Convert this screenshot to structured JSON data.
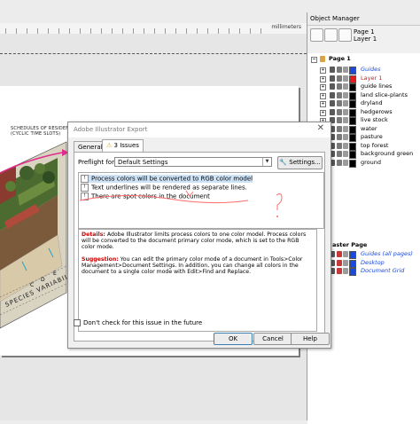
{
  "ruler": {
    "unit": "millimeters"
  },
  "illustration": {
    "schedule_caption": [
      "SCHEDULES OF RESIDEN",
      "(CYCLIC TIME SLOTS)"
    ],
    "species_caption": "SPECIES VARIABILI",
    "grid_letters": [
      "C",
      "D",
      "E"
    ]
  },
  "object_manager": {
    "title": "Object Manager",
    "page_label": "Page 1",
    "layer_label": "Layer 1",
    "page1_header": "Page 1",
    "layers": [
      {
        "name": "Guides",
        "color": "#1c49d6",
        "italic": true,
        "blue": true
      },
      {
        "name": "Layer 1",
        "color": "#e41c1c",
        "red": true
      },
      {
        "name": "guide lines",
        "color": "#000000"
      },
      {
        "name": "land slice-plants",
        "color": "#000000"
      },
      {
        "name": "dryland",
        "color": "#000000"
      },
      {
        "name": "hedgerows",
        "color": "#000000"
      },
      {
        "name": "live stock",
        "color": "#000000"
      },
      {
        "name": "water",
        "color": "#000000"
      },
      {
        "name": "pasture",
        "color": "#000000"
      },
      {
        "name": "top forest",
        "color": "#000000"
      },
      {
        "name": "background green",
        "color": "#000000"
      },
      {
        "name": "ground",
        "color": "#000000"
      }
    ],
    "master_header": "aster Page",
    "master_layers": [
      {
        "name": "Guides (all pages)",
        "color": "#1c49d6"
      },
      {
        "name": "Desktop",
        "color": "#1c49d6"
      },
      {
        "name": "Document Grid",
        "color": "#1c49d6"
      }
    ]
  },
  "dialog": {
    "title": "Adobe Illustrator Export",
    "tabs": [
      "General",
      "3 Issues"
    ],
    "preflight_label": "Preflight for:",
    "preflight_value": "Default Settings",
    "settings_label": "Settings...",
    "issues": [
      "Process colors will be converted to RGB color model",
      "Text underlines will be rendered as separate lines.",
      "There are spot colors in the document"
    ],
    "details_label": "Details:",
    "details_text": "Adobe Illustrator limits process colors to one color model. Process colors will be converted to the document primary color mode, which is set to the RGB color mode.",
    "suggestion_label": "Suggestion:",
    "suggestion_text": "You can edit the primary color mode of a document in Tools>Color Management>Document Settings. In addition, you can change all colors in the document to a single color mode with Edit>Find and Replace.",
    "dont_check_label": "Don't check for this issue in the future",
    "ok_label": "OK",
    "cancel_label": "Cancel",
    "help_label": "Help"
  },
  "colors": {
    "accent": "#cfe3f7",
    "annotation": "#ff6b6b"
  }
}
